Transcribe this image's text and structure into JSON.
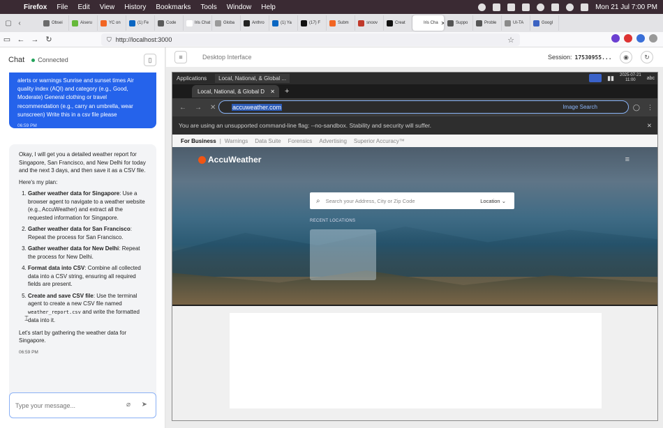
{
  "mac_menubar": {
    "app_name": "Firefox",
    "menus": [
      "File",
      "Edit",
      "View",
      "History",
      "Bookmarks",
      "Tools",
      "Window",
      "Help"
    ],
    "clock": "Mon 21 Jul  7:00 PM"
  },
  "firefox": {
    "tabs": [
      {
        "label": "Obsei",
        "color": "#6b6b6b"
      },
      {
        "label": "Aiseru",
        "color": "#66b93a"
      },
      {
        "label": "YC on",
        "color": "#f26522"
      },
      {
        "label": "(1) Fe",
        "color": "#0a66c2"
      },
      {
        "label": "Code",
        "color": "#5a5a5a"
      },
      {
        "label": "Iris Chat",
        "color": "#ffffff"
      },
      {
        "label": "Globa",
        "color": "#9a9a9a"
      },
      {
        "label": "Anthro",
        "color": "#222222"
      },
      {
        "label": "(1) Ya",
        "color": "#0a66c2"
      },
      {
        "label": "(17) F",
        "color": "#111111"
      },
      {
        "label": "Subm",
        "color": "#f26522"
      },
      {
        "label": "snoov",
        "color": "#c0392b"
      },
      {
        "label": "Creat",
        "color": "#111111"
      },
      {
        "label": "Iris Cha",
        "color": "#ffffff",
        "active": true
      },
      {
        "label": "Suppo",
        "color": "#555555"
      },
      {
        "label": "Proble",
        "color": "#555555"
      },
      {
        "label": "UI-TA",
        "color": "#8a8a8a"
      },
      {
        "label": "Googl",
        "color": "#3c63c2"
      }
    ],
    "url": "http://localhost:3000"
  },
  "chat": {
    "title": "Chat",
    "status": "Connected",
    "user_message": {
      "text": "alerts or warnings Sunrise and sunset times Air quality index (AQI) and category (e.g., Good, Moderate) General clothing or travel recommendation (e.g., carry an umbrella, wear sunscreen) Write this in a csv file please",
      "time": "06:59 PM"
    },
    "bot_message": {
      "intro": "Okay, I will get you a detailed weather report for Singapore, San Francisco, and New Delhi for today and the next 3 days, and then save it as a CSV file.",
      "plan_label": "Here's my plan:",
      "steps": [
        {
          "title": "Gather weather data for Singapore",
          "text": ": Use a browser agent to navigate to a weather website (e.g., AccuWeather) and extract all the requested information for Singapore."
        },
        {
          "title": "Gather weather data for San Francisco",
          "text": ": Repeat the process for San Francisco."
        },
        {
          "title": "Gather weather data for New Delhi",
          "text": ": Repeat the process for New Delhi."
        },
        {
          "title": "Format data into CSV",
          "text": ": Combine all collected data into a CSV string, ensuring all required fields are present."
        },
        {
          "title": "Create and save CSV file",
          "text": ": Use the terminal agent to create a new CSV file named",
          "code": "weather_report.csv",
          "text2": "and write the formatted data into it."
        }
      ],
      "outro": "Let's start by gathering the weather data for Singapore.",
      "time": "06:59 PM"
    },
    "input_placeholder": "Type your message..."
  },
  "desktop": {
    "title": "Desktop Interface",
    "session_label": "Session:",
    "session_id": "17530955...",
    "taskbar": {
      "applications": "Applications",
      "task_title": "Local, National, & Global ...",
      "date": "2025-07-21",
      "time": "11:00",
      "user": "abc"
    },
    "chrome": {
      "tab_title": "Local, National, & Global D",
      "url": "accuweather.com",
      "image_search": "Image Search",
      "warning": "You are using an unsupported command-line flag: --no-sandbox. Stability and security will suffer."
    },
    "accuweather": {
      "top_links": [
        "For Business",
        "Warnings",
        "Data Suite",
        "Forensics",
        "Advertising",
        "Superior Accuracy™"
      ],
      "logo": "AccuWeather",
      "search_placeholder": "Search your Address, City or Zip Code",
      "location_button": "Location",
      "recent_locations": "RECENT LOCATIONS"
    }
  }
}
